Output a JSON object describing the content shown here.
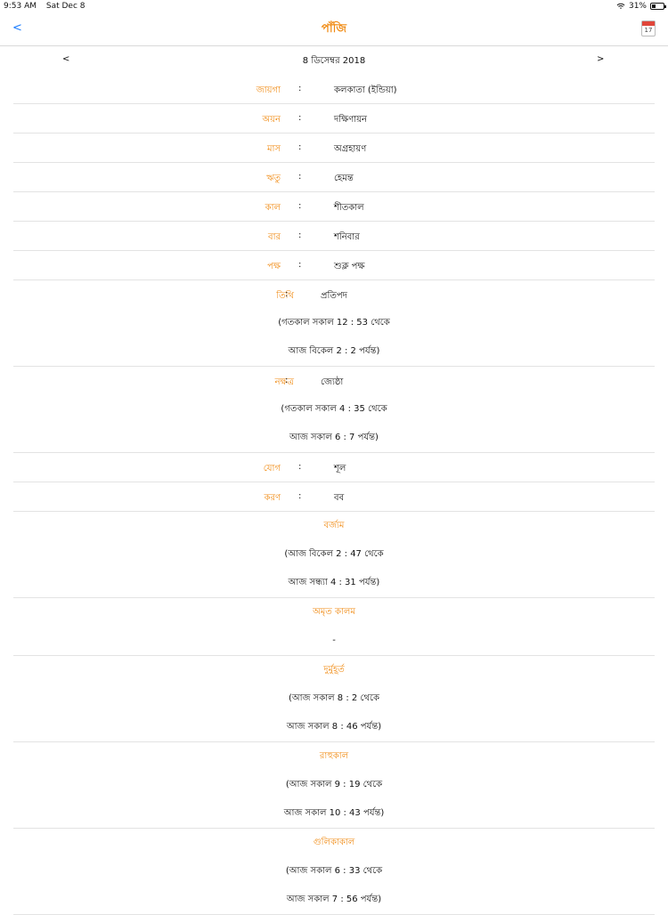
{
  "status": {
    "time": "9:53 AM",
    "date": "Sat Dec 8",
    "battery": "31%",
    "battery_level": 0.31
  },
  "nav": {
    "back": "<",
    "title": "পাঁজি",
    "calendar_icon_day": "17"
  },
  "date_nav": {
    "prev": "<",
    "date": "8 ডিসেম্বর 2018",
    "next": ">"
  },
  "rows": [
    {
      "key": "জায়গা",
      "value": "কলকাতা (ইন্ডিয়া)"
    },
    {
      "key": "অয়ন",
      "value": "দক্ষিণায়ন"
    },
    {
      "key": "মাস",
      "value": "অগ্রহায়ণ"
    },
    {
      "key": "ঋতু",
      "value": "হেমন্ত"
    },
    {
      "key": "কাল",
      "value": "শীতকাল"
    },
    {
      "key": "বার",
      "value": "শনিবার"
    },
    {
      "key": "পক্ষ",
      "value": "শুক্ল পক্ষ"
    }
  ],
  "tithi": {
    "key": "তিথি",
    "value": "প্রতিপদ",
    "line1": "(গতকাল সকাল 12 : 53   থেকে",
    "line2": "আজ বিকেল 2 : 2   পর্যন্ত)"
  },
  "nakshatra": {
    "key": "নক্ষত্র",
    "value": "জ্যেষ্ঠা",
    "line1": "(গতকাল সকাল 4 : 35   থেকে",
    "line2": "আজ সকাল 6 : 7   পর্যন্ত)"
  },
  "yoga": {
    "key": "যোগ",
    "value": "শূল"
  },
  "karana": {
    "key": "করণ",
    "value": "বব"
  },
  "blocks": [
    {
      "title": "বর্জ্যম",
      "line1": "(আজ বিকেল 2 : 47   থেকে",
      "line2": "আজ সন্ধ্যা 4 : 31   পর্যন্ত)"
    },
    {
      "title": "অমৃত কালম",
      "line1": "-",
      "line2": ""
    },
    {
      "title": "দুর্মুহূর্ত",
      "line1": "(আজ সকাল 8 : 2   থেকে",
      "line2": "আজ সকাল 8 : 46   পর্যন্ত)"
    },
    {
      "title": "রাহুকাল",
      "line1": "(আজ সকাল 9 : 19   থেকে",
      "line2": "আজ সকাল 10 : 43   পর্যন্ত)"
    },
    {
      "title": "গুলিকাকাল",
      "line1": "(আজ সকাল 6 : 33   থেকে",
      "line2": "আজ সকাল 7 : 56   পর্যন্ত)"
    }
  ],
  "colors": {
    "accent": "#f08a12",
    "link": "#1a7cff",
    "divider": "#e3e3e3"
  }
}
